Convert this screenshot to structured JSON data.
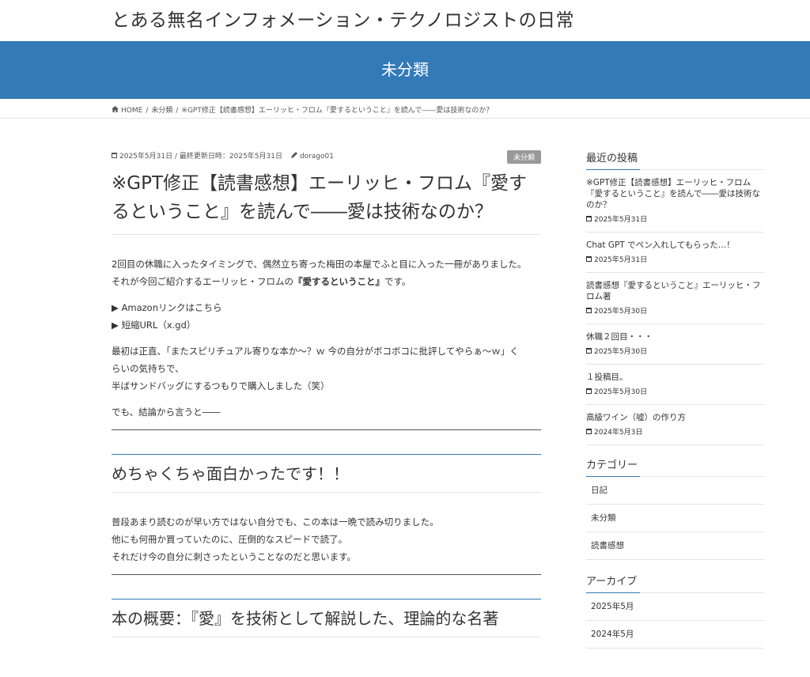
{
  "site": {
    "title": "とある無名インフォメーション・テクノロジストの日常"
  },
  "banner": {
    "title": "未分類"
  },
  "breadcrumb": {
    "home": "HOME",
    "category": "未分類",
    "current": "※GPT修正【読書感想】エーリッヒ・フロム『愛するということ』を読んで――愛は技術なのか？"
  },
  "post": {
    "published": "2025年5月31日",
    "updated_prefix": "最終更新日時：",
    "updated": "2025年5月31日",
    "author": "dorago01",
    "category_badge": "未分類",
    "title": "※GPT修正【読書感想】エーリッヒ・フロム『愛するということ』を読んで――愛は技術なのか？",
    "p1_line1": "2回目の休職に入ったタイミングで、偶然立ち寄った梅田の本屋でふと目に入った一冊がありました。",
    "p1_line2_pre": "それが今回ご紹介するエーリッヒ・フロムの",
    "p1_line2_bold": "『愛するということ』",
    "p1_line2_post": "です。",
    "link_amazon": "▶ Amazonリンクはこちら",
    "link_short": "▶ 短縮URL（x.gd）",
    "p2_line1": "最初は正直、「またスピリチュアル寄りな本か～？ｗ 今の自分がボコボコに批評してやらぁ～ｗ」く",
    "p2_line2": "らいの気持ちで、",
    "p2_line3": "半ばサンドバッグにするつもりで購入しました（笑）",
    "p3": "でも、結論から言うと――",
    "h2_1": "めちゃくちゃ面白かったです！！",
    "p4_line1": "普段あまり読むのが早い方ではない自分でも、この本は一晩で読み切りました。",
    "p4_line2": "他にも何冊か買っていたのに、圧倒的なスピードで読了。",
    "p4_line3": "それだけ今の自分に刺さったということなのだと思います。",
    "h2_2": "本の概要：『愛』を技術として解説した、理論的な名著"
  },
  "sidebar": {
    "recent_title": "最近の投稿",
    "recent": [
      {
        "title": "※GPT修正【読書感想】エーリッヒ・フロム『愛するということ』を読んで――愛は技術なのか？",
        "date": "2025年5月31日"
      },
      {
        "title": "Chat GPT でペン入れしてもらった…！",
        "date": "2025年5月31日"
      },
      {
        "title": "読書感想『愛するということ』エーリッヒ・フロム著",
        "date": "2025年5月30日"
      },
      {
        "title": "休職２回目・・・",
        "date": "2025年5月30日"
      },
      {
        "title": "１投稿目。",
        "date": "2025年5月30日"
      },
      {
        "title": "高級ワイン（嘘）の作り方",
        "date": "2024年5月3日"
      }
    ],
    "category_title": "カテゴリー",
    "categories": [
      "日記",
      "未分類",
      "読書感想"
    ],
    "archive_title": "アーカイブ",
    "archives": [
      "2025年5月",
      "2024年5月"
    ]
  },
  "icons": {
    "home": "home-icon",
    "calendar": "calendar-icon",
    "pencil": "pencil-icon"
  },
  "colors": {
    "accent": "#337ab7",
    "badge": "#999999"
  }
}
